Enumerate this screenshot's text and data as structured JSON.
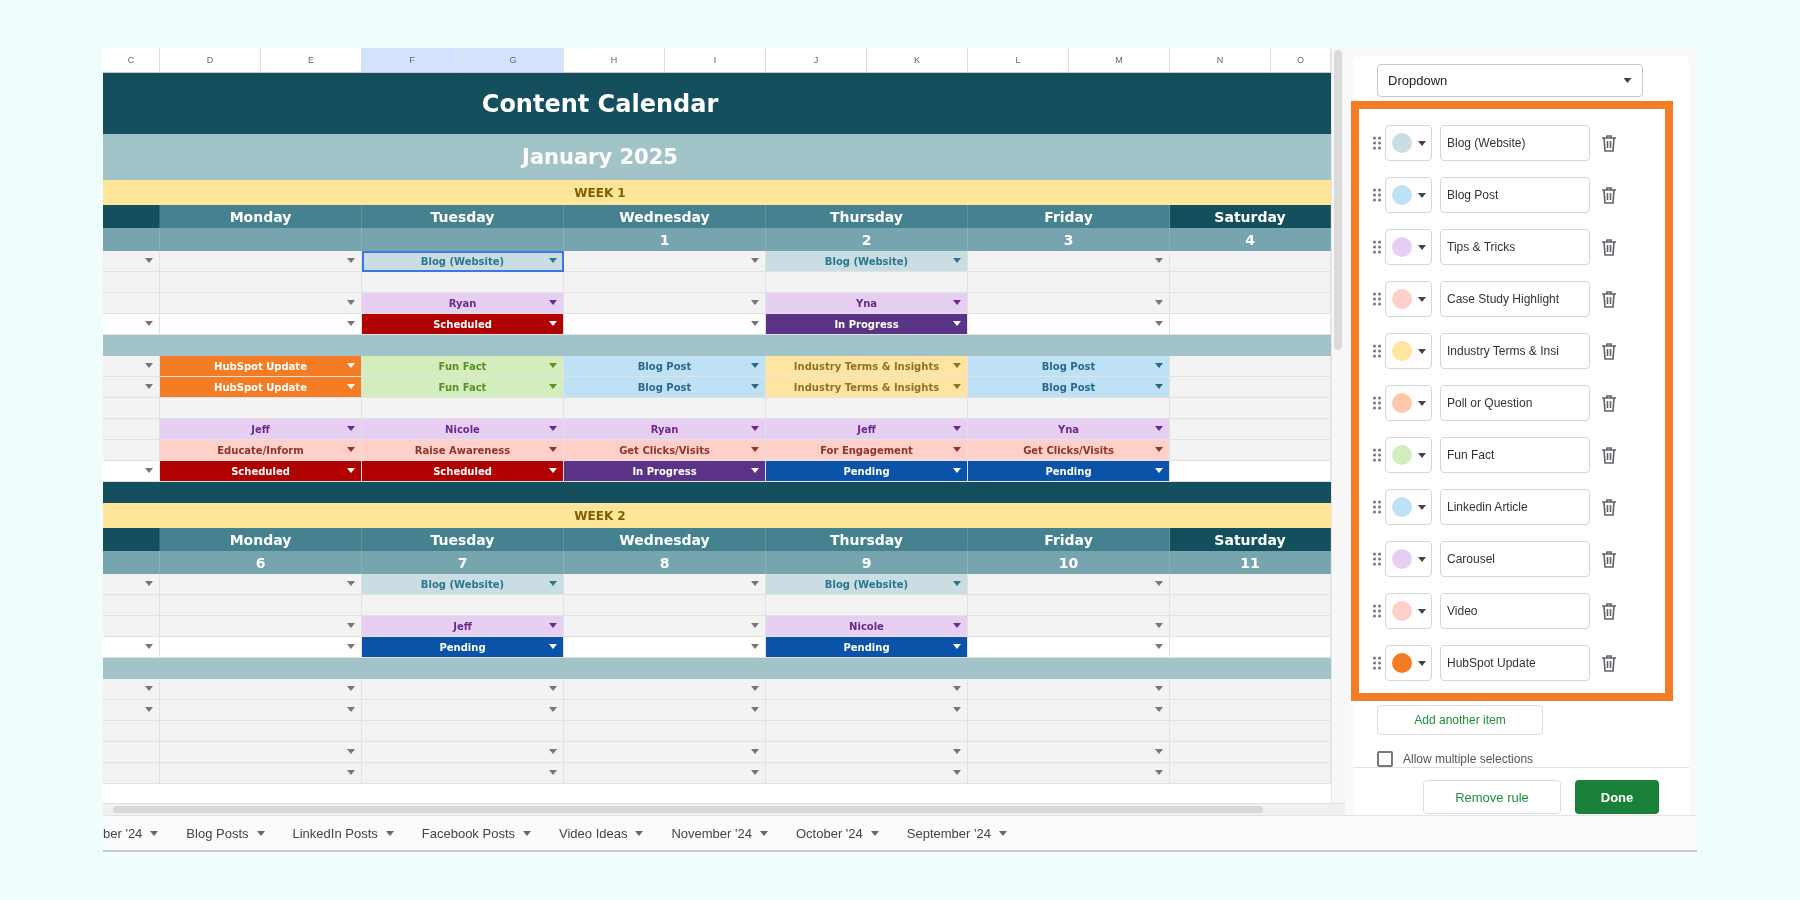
{
  "column_headers": [
    {
      "label": "C",
      "selected": false
    },
    {
      "label": "D",
      "selected": false
    },
    {
      "label": "E",
      "selected": false
    },
    {
      "label": "F",
      "selected": true
    },
    {
      "label": "G",
      "selected": true
    },
    {
      "label": "H",
      "selected": false
    },
    {
      "label": "I",
      "selected": false
    },
    {
      "label": "J",
      "selected": false
    },
    {
      "label": "K",
      "selected": false
    },
    {
      "label": "L",
      "selected": false
    },
    {
      "label": "M",
      "selected": false
    },
    {
      "label": "N",
      "selected": false
    },
    {
      "label": "O",
      "selected": false
    }
  ],
  "title": "Content Calendar",
  "month": "January 2025",
  "weeks": [
    {
      "label": "WEEK 1",
      "days": [
        {
          "name": "Monday"
        },
        {
          "name": "Tuesday"
        },
        {
          "name": "Wednesday",
          "date": "1"
        },
        {
          "name": "Thursday",
          "date": "2"
        },
        {
          "name": "Friday",
          "date": "3"
        },
        {
          "name": "Saturday",
          "date": "4"
        }
      ],
      "rows": [
        {
          "kind": "entry",
          "cells": [
            {
              "dropdown": true
            },
            {
              "dropdown": true
            },
            {
              "text": "Blog (Website)",
              "color": "#c9dde3",
              "dropdown": true,
              "active": true
            },
            {
              "dropdown": true
            },
            {
              "text": "Blog (Website)",
              "color": "#c9dde3",
              "dropdown": true
            },
            {
              "dropdown": true
            },
            {
              "dropdown": false
            }
          ]
        },
        {
          "kind": "entry",
          "cells": [
            {
              "dropdown": false
            },
            {
              "dropdown": false
            },
            {
              "dropdown": false
            },
            {
              "dropdown": false
            },
            {
              "dropdown": false
            },
            {
              "dropdown": false
            },
            {
              "dropdown": false
            }
          ]
        },
        {
          "kind": "entry",
          "cells": [
            {
              "dropdown": false
            },
            {
              "dropdown": true
            },
            {
              "text": "Ryan",
              "color": "#e6cff2",
              "dropdown": true
            },
            {
              "dropdown": true
            },
            {
              "text": "Yna",
              "color": "#e6cff2",
              "dropdown": true
            },
            {
              "dropdown": true
            },
            {
              "dropdown": false
            }
          ]
        },
        {
          "kind": "status",
          "cells": [
            {
              "dropdown": true
            },
            {
              "dropdown": true
            },
            {
              "text": "Scheduled",
              "color": "#b10202",
              "dropdown": true
            },
            {
              "dropdown": true
            },
            {
              "text": "In Progress",
              "color": "#5a3286",
              "dropdown": true
            },
            {
              "dropdown": true
            },
            {
              "dropdown": false
            }
          ]
        },
        {
          "kind": "separator"
        },
        {
          "kind": "entry",
          "cells": [
            {
              "dropdown": true
            },
            {
              "text": "HubSpot Update",
              "color": "#f47c24",
              "dropdown": true
            },
            {
              "text": "Fun Fact",
              "color": "#d4edbc",
              "dropdown": true
            },
            {
              "text": "Blog Post",
              "color": "#bfe1f6",
              "dropdown": true
            },
            {
              "text": "Industry Terms & Insights",
              "color": "#ffe5a0",
              "dropdown": true
            },
            {
              "text": "Blog Post",
              "color": "#bfe1f6",
              "dropdown": true
            },
            {
              "dropdown": false
            }
          ]
        },
        {
          "kind": "entry",
          "cells": [
            {
              "dropdown": true
            },
            {
              "text": "HubSpot Update",
              "color": "#f47c24",
              "dropdown": true
            },
            {
              "text": "Fun Fact",
              "color": "#d4edbc",
              "dropdown": true
            },
            {
              "text": "Blog Post",
              "color": "#bfe1f6",
              "dropdown": true
            },
            {
              "text": "Industry Terms & Insights",
              "color": "#ffe5a0",
              "dropdown": true
            },
            {
              "text": "Blog Post",
              "color": "#bfe1f6",
              "dropdown": true
            },
            {
              "dropdown": false
            }
          ]
        },
        {
          "kind": "entry",
          "cells": [
            {
              "dropdown": false
            },
            {
              "dropdown": false
            },
            {
              "dropdown": false
            },
            {
              "dropdown": false
            },
            {
              "dropdown": false
            },
            {
              "dropdown": false
            },
            {
              "dropdown": false
            }
          ]
        },
        {
          "kind": "entry",
          "cells": [
            {
              "dropdown": false
            },
            {
              "text": "Jeff",
              "color": "#e6cff2",
              "dropdown": true
            },
            {
              "text": "Nicole",
              "color": "#e6cff2",
              "dropdown": true
            },
            {
              "text": "Ryan",
              "color": "#e6cff2",
              "dropdown": true
            },
            {
              "text": "Jeff",
              "color": "#e6cff2",
              "dropdown": true
            },
            {
              "text": "Yna",
              "color": "#e6cff2",
              "dropdown": true
            },
            {
              "dropdown": false
            }
          ]
        },
        {
          "kind": "entry",
          "cells": [
            {
              "dropdown": false
            },
            {
              "text": "Educate/Inform",
              "color": "#ffcfc9",
              "dropdown": true
            },
            {
              "text": "Raise Awareness",
              "color": "#ffcfc9",
              "dropdown": true
            },
            {
              "text": "Get Clicks/Visits",
              "color": "#ffcfc9",
              "dropdown": true
            },
            {
              "text": "For Engagement",
              "color": "#ffcfc9",
              "dropdown": true
            },
            {
              "text": "Get Clicks/Visits",
              "color": "#ffcfc9",
              "dropdown": true
            },
            {
              "dropdown": false
            }
          ]
        },
        {
          "kind": "status",
          "cells": [
            {
              "dropdown": true
            },
            {
              "text": "Scheduled",
              "color": "#b10202",
              "dropdown": true
            },
            {
              "text": "Scheduled",
              "color": "#b10202",
              "dropdown": true
            },
            {
              "text": "In Progress",
              "color": "#5a3286",
              "dropdown": true
            },
            {
              "text": "Pending",
              "color": "#0a53a8",
              "dropdown": true
            },
            {
              "text": "Pending",
              "color": "#0a53a8",
              "dropdown": true
            },
            {
              "dropdown": false
            }
          ]
        },
        {
          "kind": "band"
        }
      ]
    },
    {
      "label": "WEEK 2",
      "days": [
        {
          "name": "Monday",
          "date": "6"
        },
        {
          "name": "Tuesday",
          "date": "7"
        },
        {
          "name": "Wednesday",
          "date": "8"
        },
        {
          "name": "Thursday",
          "date": "9"
        },
        {
          "name": "Friday",
          "date": "10"
        },
        {
          "name": "Saturday",
          "date": "11"
        }
      ],
      "rows": [
        {
          "kind": "entry",
          "cells": [
            {
              "dropdown": true
            },
            {
              "dropdown": true
            },
            {
              "text": "Blog (Website)",
              "color": "#c9dde3",
              "dropdown": true
            },
            {
              "dropdown": true
            },
            {
              "text": "Blog (Website)",
              "color": "#c9dde3",
              "dropdown": true
            },
            {
              "dropdown": true
            },
            {
              "dropdown": false
            }
          ]
        },
        {
          "kind": "entry",
          "cells": [
            {
              "dropdown": false
            },
            {
              "dropdown": false
            },
            {
              "dropdown": false
            },
            {
              "dropdown": false
            },
            {
              "dropdown": false
            },
            {
              "dropdown": false
            },
            {
              "dropdown": false
            }
          ]
        },
        {
          "kind": "entry",
          "cells": [
            {
              "dropdown": false
            },
            {
              "dropdown": true
            },
            {
              "text": "Jeff",
              "color": "#e6cff2",
              "dropdown": true
            },
            {
              "dropdown": true
            },
            {
              "text": "Nicole",
              "color": "#e6cff2",
              "dropdown": true
            },
            {
              "dropdown": true
            },
            {
              "dropdown": false
            }
          ]
        },
        {
          "kind": "status",
          "cells": [
            {
              "dropdown": true
            },
            {
              "dropdown": true
            },
            {
              "text": "Pending",
              "color": "#0a53a8",
              "dropdown": true
            },
            {
              "dropdown": true
            },
            {
              "text": "Pending",
              "color": "#0a53a8",
              "dropdown": true
            },
            {
              "dropdown": true
            },
            {
              "dropdown": false
            }
          ]
        },
        {
          "kind": "separator"
        },
        {
          "kind": "entry",
          "cells": [
            {
              "dropdown": true
            },
            {
              "dropdown": true
            },
            {
              "dropdown": true
            },
            {
              "dropdown": true
            },
            {
              "dropdown": true
            },
            {
              "dropdown": true
            },
            {
              "dropdown": false
            }
          ]
        },
        {
          "kind": "entry",
          "cells": [
            {
              "dropdown": true
            },
            {
              "dropdown": true
            },
            {
              "dropdown": true
            },
            {
              "dropdown": true
            },
            {
              "dropdown": true
            },
            {
              "dropdown": true
            },
            {
              "dropdown": false
            }
          ]
        },
        {
          "kind": "entry",
          "cells": [
            {
              "dropdown": false
            },
            {
              "dropdown": false
            },
            {
              "dropdown": false
            },
            {
              "dropdown": false
            },
            {
              "dropdown": false
            },
            {
              "dropdown": false
            },
            {
              "dropdown": false
            }
          ]
        },
        {
          "kind": "entry",
          "cells": [
            {
              "dropdown": false
            },
            {
              "dropdown": true
            },
            {
              "dropdown": true
            },
            {
              "dropdown": true
            },
            {
              "dropdown": true
            },
            {
              "dropdown": true
            },
            {
              "dropdown": false
            }
          ]
        },
        {
          "kind": "entry",
          "cells": [
            {
              "dropdown": false
            },
            {
              "dropdown": true
            },
            {
              "dropdown": true
            },
            {
              "dropdown": true
            },
            {
              "dropdown": true
            },
            {
              "dropdown": true
            },
            {
              "dropdown": false
            }
          ]
        }
      ]
    }
  ],
  "sheet_tabs": [
    {
      "label": "ber '24"
    },
    {
      "label": "Blog Posts"
    },
    {
      "label": "LinkedIn Posts"
    },
    {
      "label": "Facebook Posts"
    },
    {
      "label": "Video Ideas"
    },
    {
      "label": "November '24"
    },
    {
      "label": "October '24"
    },
    {
      "label": "September '24"
    }
  ],
  "panel": {
    "criteria": "Dropdown",
    "items": [
      {
        "text": "Blog (Website)",
        "color": "#c9dde3"
      },
      {
        "text": "Blog Post",
        "color": "#bfe1f6"
      },
      {
        "text": "Tips & Tricks",
        "color": "#e6cff2"
      },
      {
        "text": "Case Study Highlight",
        "color": "#ffcfc9"
      },
      {
        "text": "Industry Terms & Insi",
        "color": "#ffe5a0"
      },
      {
        "text": "Poll or Question",
        "color": "#ffc8aa"
      },
      {
        "text": "Fun Fact",
        "color": "#d4edbc"
      },
      {
        "text": "Linkedin Article",
        "color": "#bfe1f6"
      },
      {
        "text": "Carousel",
        "color": "#e6cff2"
      },
      {
        "text": "Video",
        "color": "#ffcfc9"
      },
      {
        "text": "HubSpot Update",
        "color": "#f47c24"
      }
    ],
    "add_button": "Add another item",
    "multiple_selections": {
      "label": "Allow multiple selections",
      "checked": false
    },
    "remove_button": "Remove rule",
    "done_button": "Done"
  }
}
